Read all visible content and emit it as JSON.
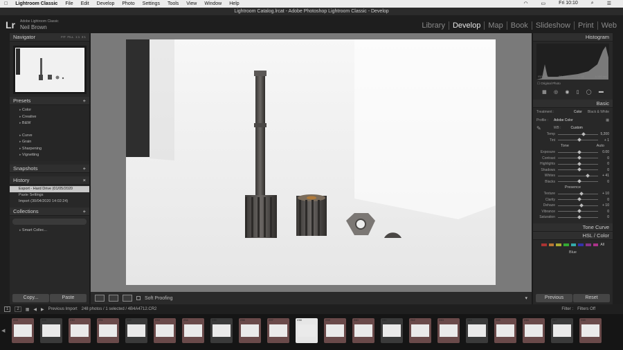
{
  "menubar": {
    "apple": "",
    "app_name": "Lightroom Classic",
    "items": [
      "File",
      "Edit",
      "Develop",
      "Photo",
      "Settings",
      "Tools",
      "View",
      "Window",
      "Help"
    ],
    "clock": "Fri 10:10"
  },
  "window_title": "Lightroom Catalog.lrcat - Adobe Photoshop Lightroom Classic - Develop",
  "identity": {
    "logo": "Lr",
    "product": "Adobe Lightroom Classic",
    "user": "Neil Brown"
  },
  "modules": [
    "Library",
    "Develop",
    "Map",
    "Book",
    "Slideshow",
    "Print",
    "Web"
  ],
  "active_module": "Develop",
  "left_panel": {
    "navigator": {
      "title": "Navigator",
      "zoom_options": [
        "FIT",
        "FILL",
        "1:1",
        "3:1"
      ]
    },
    "presets": {
      "title": "Presets",
      "items": [
        "Color",
        "Creative",
        "B&W",
        "Curve",
        "Grain",
        "Sharpening",
        "Vignetting"
      ]
    },
    "snapshots": {
      "title": "Snapshots"
    },
    "history": {
      "title": "History",
      "items": [
        "Export - Hard Drive (01/05/2020 10:31:23)",
        "Paste Settings",
        "Import (30/04/2020 14:02:24)"
      ]
    },
    "collections": {
      "title": "Collections",
      "items": [
        "Smart Collec..."
      ]
    },
    "copy_label": "Copy...",
    "paste_label": "Paste"
  },
  "toolbar": {
    "soft_proofing": "Soft Proofing"
  },
  "filmbar": {
    "pages": [
      "1",
      "2"
    ],
    "source": "Previous Import",
    "count": "248 photos / 1 selected / 4B4A4712.CR2",
    "filter_label": "Filter :",
    "filters_off": "Filters Off"
  },
  "right_panel": {
    "histogram": {
      "title": "Histogram",
      "iso": "ISO 100",
      "focal": "84 mm",
      "aperture": "f / 11",
      "shutter": "1/160 sec",
      "original_photo": "Original Photo"
    },
    "basic": {
      "title": "Basic",
      "treatment_label": "Treatment :",
      "color_label": "Color",
      "bw_label": "Black & White",
      "profile_label": "Profile :",
      "profile_value": "Adobe Color",
      "wb_label": "WB :",
      "wb_value": "Custom",
      "tone_label": "Tone",
      "auto_label": "Auto",
      "presence_label": "Presence"
    },
    "sliders_wb": [
      {
        "label": "Temp",
        "value": "5,200",
        "pos": 0.6
      },
      {
        "label": "Tint",
        "value": "+ 1",
        "pos": 0.5
      }
    ],
    "sliders_tone": [
      {
        "label": "Exposure",
        "value": "0.00",
        "pos": 0.5
      },
      {
        "label": "Contrast",
        "value": "0",
        "pos": 0.5
      },
      {
        "label": "Highlights",
        "value": "0",
        "pos": 0.5
      },
      {
        "label": "Shadows",
        "value": "0",
        "pos": 0.5
      },
      {
        "label": "Whites",
        "value": "+ 41",
        "pos": 0.7
      },
      {
        "label": "Blacks",
        "value": "0",
        "pos": 0.5
      }
    ],
    "sliders_presence": [
      {
        "label": "Texture",
        "value": "+ 10",
        "pos": 0.55
      },
      {
        "label": "Clarity",
        "value": "0",
        "pos": 0.5
      },
      {
        "label": "Dehaze",
        "value": "+ 10",
        "pos": 0.55
      },
      {
        "label": "Vibrance",
        "value": "0",
        "pos": 0.5
      },
      {
        "label": "Saturation",
        "value": "0",
        "pos": 0.5
      }
    ],
    "tone_curve": "Tone Curve",
    "hsl": "HSL / Color",
    "hsl_all": "All",
    "hsl_blue": "Blue",
    "previous_label": "Previous",
    "reset_label": "Reset"
  },
  "filmstrip_numbers": [
    "228",
    "229",
    "230",
    "231",
    "232",
    "233",
    "234",
    "235",
    "236",
    "237",
    "238",
    "239",
    "240",
    "241",
    "242",
    "243",
    "244",
    "245",
    "246",
    "247",
    "248"
  ],
  "colors": {
    "accent_red": "#8d3b3b",
    "panel": "#282828",
    "workspace": "#7a7a7a"
  }
}
